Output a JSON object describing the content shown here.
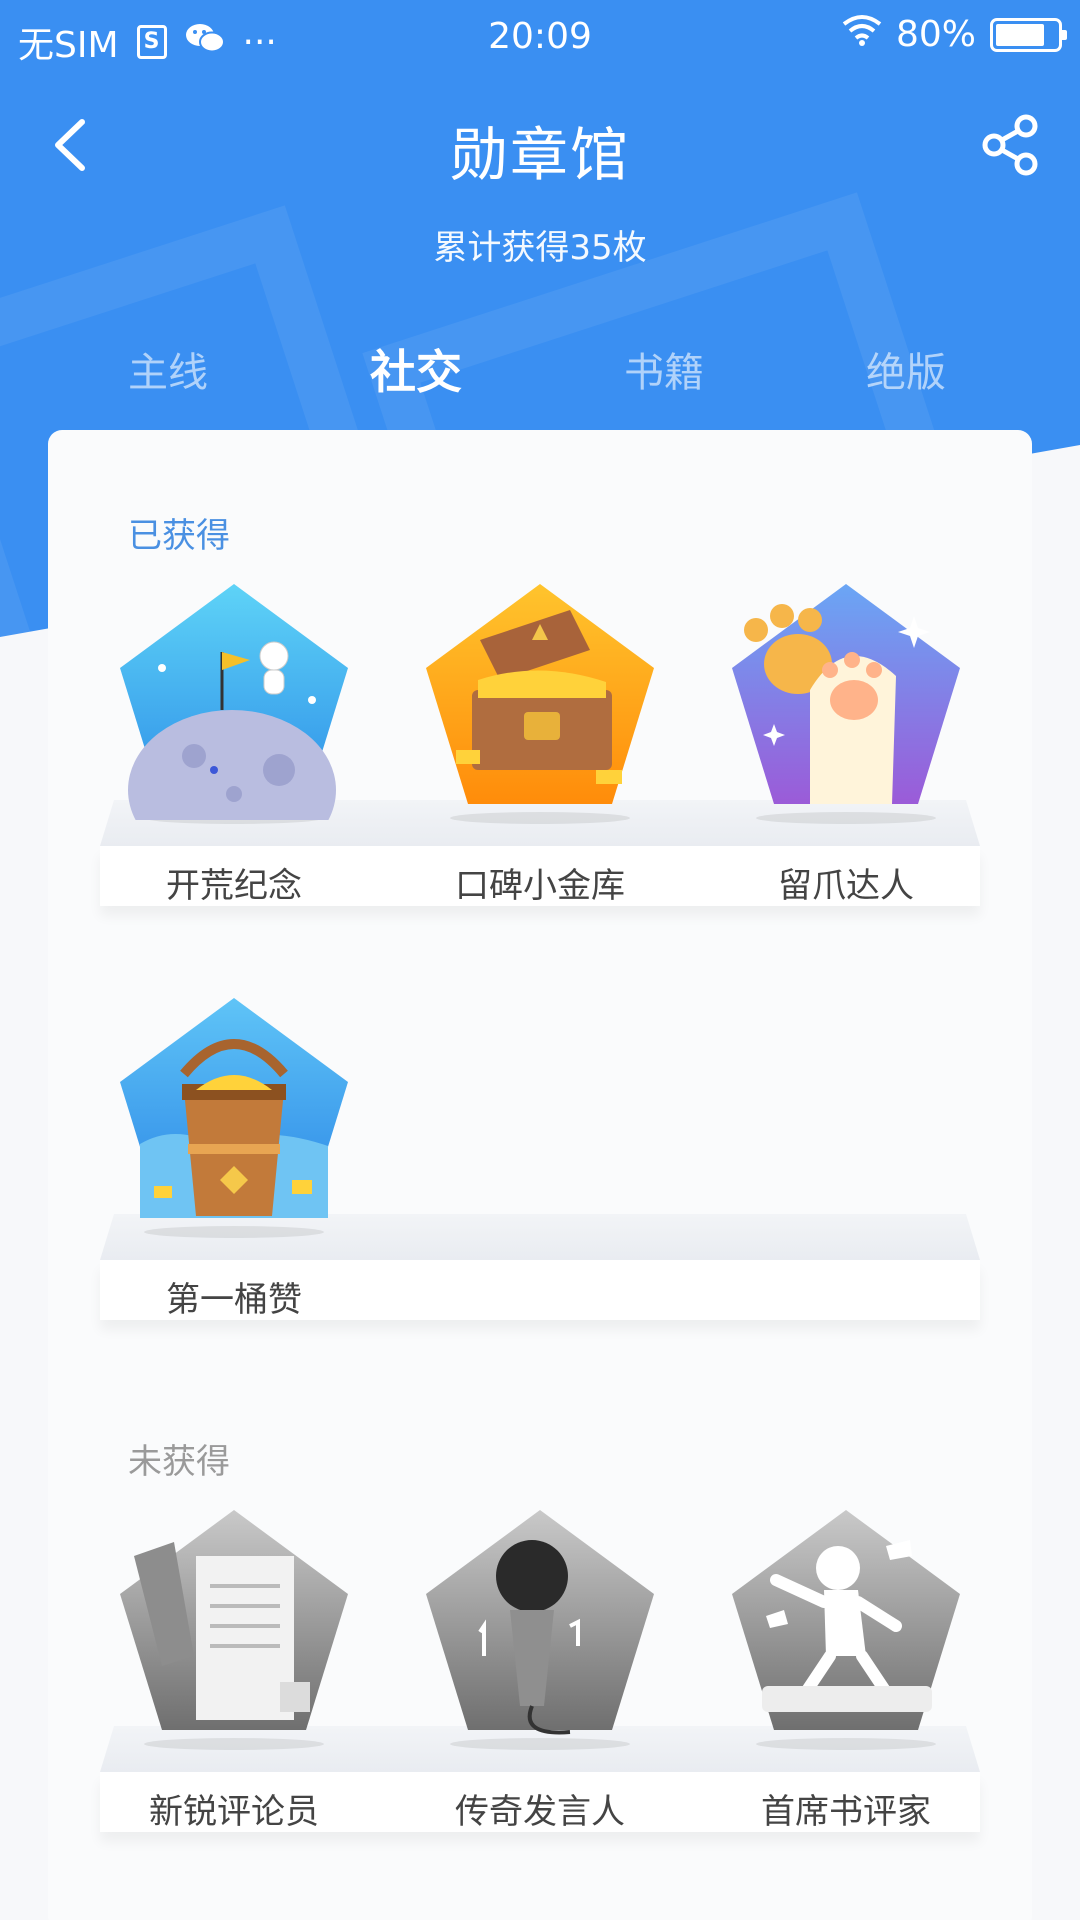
{
  "status_bar": {
    "carrier": "无SIM",
    "time": "20:09",
    "battery": "80%",
    "battery_level": 0.8
  },
  "nav": {
    "title": "勋章馆"
  },
  "summary": "累计获得35枚",
  "tabs": [
    {
      "label": "主线",
      "active": false
    },
    {
      "label": "社交",
      "active": true
    },
    {
      "label": "书籍",
      "active": false
    },
    {
      "label": "绝版",
      "active": false
    }
  ],
  "sections": {
    "earned": {
      "label": "已获得",
      "badges": [
        {
          "name": "开荒纪念",
          "icon": "astronaut-moon-badge-icon"
        },
        {
          "name": "口碑小金库",
          "icon": "treasure-chest-badge-icon"
        },
        {
          "name": "留爪达人",
          "icon": "cat-paw-badge-icon"
        },
        {
          "name": "第一桶赞",
          "icon": "bucket-of-likes-badge-icon"
        }
      ]
    },
    "unearned": {
      "label": "未获得",
      "badges": [
        {
          "name": "新锐评论员",
          "icon": "pen-and-paper-badge-icon"
        },
        {
          "name": "传奇发言人",
          "icon": "microphone-badge-icon"
        },
        {
          "name": "首席书评家",
          "icon": "dancing-figure-keyboard-badge-icon"
        }
      ]
    }
  },
  "colors": {
    "header_blue": "#3a8ff2",
    "earned_label": "#4a90e2",
    "unearned_label": "#9a9a9a"
  }
}
